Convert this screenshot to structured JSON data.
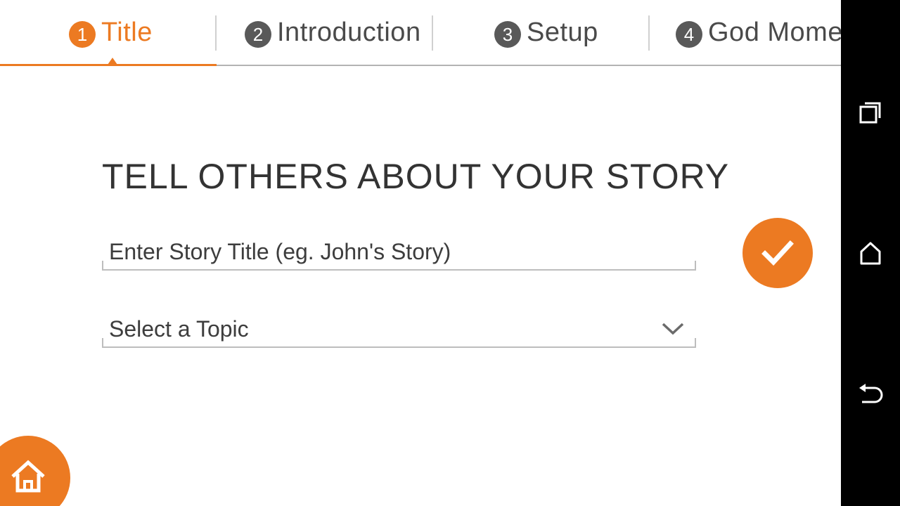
{
  "steps": [
    {
      "num": "1",
      "label": "Title"
    },
    {
      "num": "2",
      "label": "Introduction"
    },
    {
      "num": "3",
      "label": "Setup"
    },
    {
      "num": "4",
      "label": "God Moment"
    }
  ],
  "active_step": 1,
  "heading": "TELL OTHERS ABOUT YOUR STORY",
  "title_field": {
    "placeholder": "Enter Story Title (eg. John's Story)",
    "value": ""
  },
  "topic_select": {
    "placeholder": "Select a Topic"
  },
  "colors": {
    "accent": "#ec7a22",
    "step_inactive": "#595959",
    "nav_bar": "#000000"
  },
  "icons": {
    "confirm": "checkmark-icon",
    "home": "home-icon",
    "recents": "recent-apps-icon",
    "nav_home": "nav-home-icon",
    "back": "back-icon",
    "dropdown": "chevron-down-icon"
  }
}
